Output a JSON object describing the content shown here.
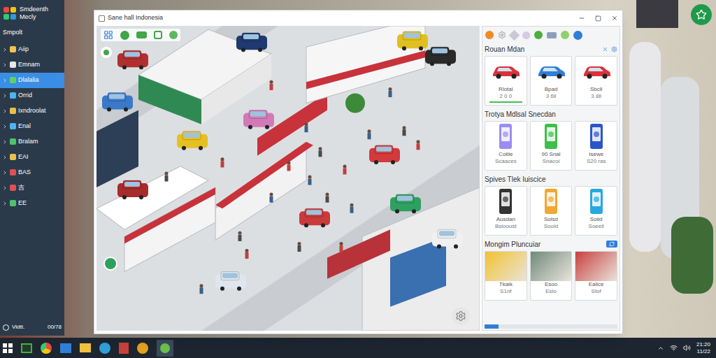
{
  "sidebar": {
    "title": "Smdeenth",
    "subtitle": "Mecly",
    "section": "Smpolt",
    "items": [
      {
        "label": "Aiip",
        "selected": false,
        "color": "#f2c14e"
      },
      {
        "label": "Emnam",
        "selected": false,
        "color": "#e8e8e8"
      },
      {
        "label": "Dlalalia",
        "selected": true,
        "color": "#5fd35f"
      },
      {
        "label": "Orrid",
        "selected": false,
        "color": "#4fb3f2"
      },
      {
        "label": "Ixndroolat",
        "selected": false,
        "color": "#e8c04a"
      },
      {
        "label": "Enal",
        "selected": false,
        "color": "#4fb3f2"
      },
      {
        "label": "Bralam",
        "selected": false,
        "color": "#4fc36b"
      },
      {
        "label": "EAI",
        "selected": false,
        "color": "#e8c04a"
      },
      {
        "label": "BAS",
        "selected": false,
        "color": "#e05050"
      },
      {
        "label": "吉",
        "selected": false,
        "color": "#e05050"
      },
      {
        "label": "EE",
        "selected": false,
        "color": "#4fc36b"
      }
    ],
    "footer": {
      "label": "Vldtt.",
      "value": "00/78"
    }
  },
  "window": {
    "title": "Sane hall Indonesia"
  },
  "panel": {
    "sections": [
      {
        "title": "Rouan Mdan",
        "kind": "car",
        "cards": [
          {
            "name": "Rlotal",
            "detail": "2 0 0",
            "color": "#d9323a",
            "selected": true
          },
          {
            "name": "Bpad",
            "detail": "3 6ll",
            "color": "#2f7fd6",
            "selected": false
          },
          {
            "name": "Sbcll",
            "detail": "3 8ll",
            "color": "#d9323a",
            "selected": false
          }
        ]
      },
      {
        "title": "Trotya Mdlsal Snecdan",
        "kind": "product",
        "cards": [
          {
            "name": "Cotile",
            "detail": "Scaaces",
            "color": "#9b8cf2",
            "selected": false
          },
          {
            "name": "90 Snal",
            "detail": "Snacoi",
            "color": "#3fbf4a",
            "selected": false
          },
          {
            "name": "Isewe",
            "detail": "S20 ras",
            "color": "#2a56c9",
            "selected": false
          }
        ]
      },
      {
        "title": "Spives Tlek Iuiscice",
        "kind": "product",
        "cards": [
          {
            "name": "Ausdan",
            "detail": "Bslooust",
            "color": "#333333",
            "selected": false
          },
          {
            "name": "Solsd",
            "detail": "Soold",
            "color": "#f0a830",
            "selected": false
          },
          {
            "name": "Soiid",
            "detail": "Soeell",
            "color": "#28a8e0",
            "selected": false
          }
        ]
      },
      {
        "title": "Mongim Pluncuiar",
        "kind": "photo",
        "cards": [
          {
            "name": "Tkaik",
            "detail": "S1nf",
            "color": "#f2c230",
            "selected": false
          },
          {
            "name": "Esoo",
            "detail": "Eslo",
            "color": "#6f8a7a",
            "selected": false
          },
          {
            "name": "Ealice",
            "detail": "Stof",
            "color": "#c84040",
            "selected": false
          }
        ]
      }
    ]
  },
  "taskbar": {
    "time": "21:20",
    "date": "11/22"
  }
}
